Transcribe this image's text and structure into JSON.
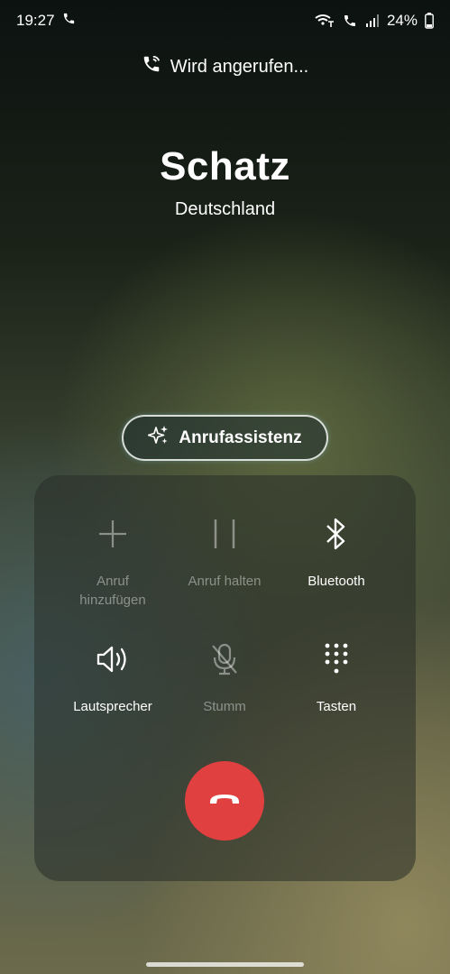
{
  "status_bar": {
    "time": "19:27",
    "battery": "24%",
    "icons": [
      "call-active-icon",
      "wifi-calling-icon",
      "volte-icon",
      "signal-icon",
      "battery-icon"
    ]
  },
  "call": {
    "status_text": "Wird angerufen...",
    "contact_name": "Schatz",
    "location": "Deutschland"
  },
  "assistant_button": {
    "label": "Anrufassistenz",
    "icon": "sparkle-icon"
  },
  "controls": {
    "add_call": {
      "label_line1": "Anruf",
      "label_line2": "hinzufügen",
      "icon": "plus-icon",
      "enabled": false
    },
    "hold_call": {
      "label": "Anruf halten",
      "icon": "pause-icon",
      "enabled": false
    },
    "bluetooth": {
      "label": "Bluetooth",
      "icon": "bluetooth-icon",
      "enabled": true
    },
    "speaker": {
      "label": "Lautsprecher",
      "icon": "speaker-icon",
      "enabled": true
    },
    "mute": {
      "label": "Stumm",
      "icon": "mic-off-icon",
      "enabled": false
    },
    "keypad": {
      "label": "Tasten",
      "icon": "keypad-icon",
      "enabled": true
    }
  },
  "end_call": {
    "icon": "hang-up-icon",
    "color": "#e04040"
  },
  "colors": {
    "end_call_red": "#e04040",
    "text": "#ffffff"
  }
}
